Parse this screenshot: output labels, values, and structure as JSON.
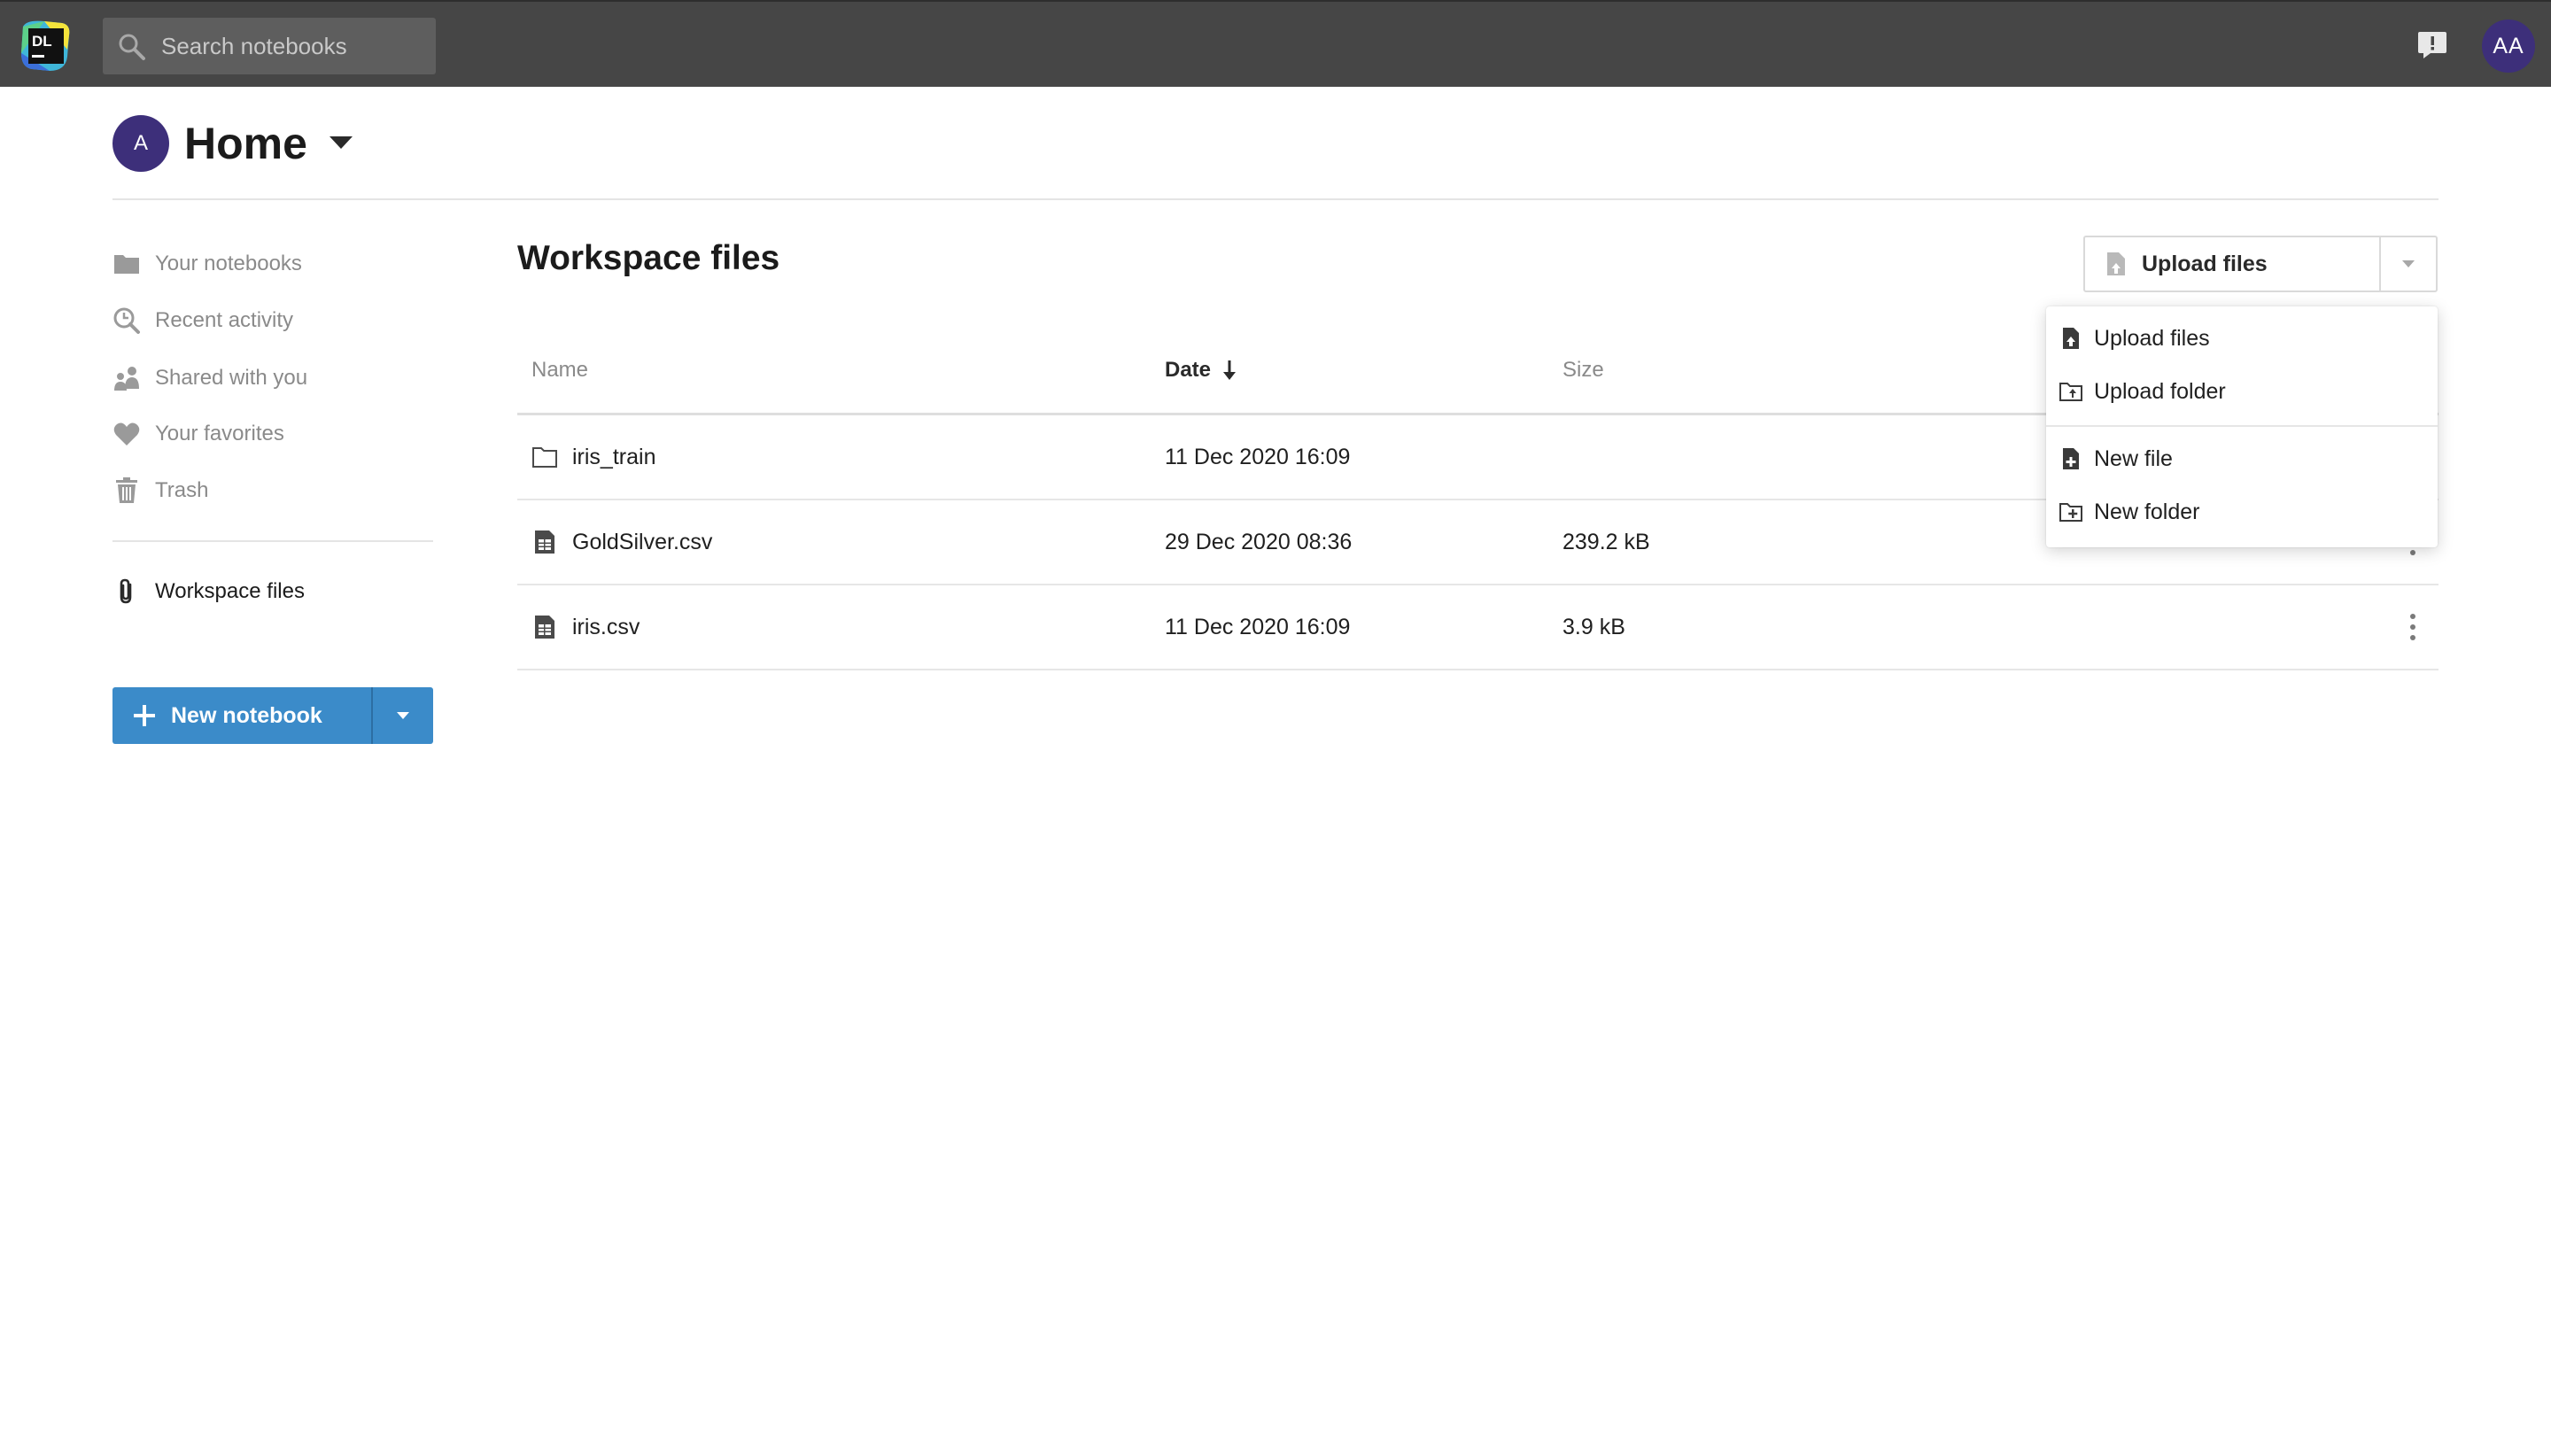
{
  "topbar": {
    "logo_text": "DL",
    "search_placeholder": "Search notebooks",
    "user_initials": "AA"
  },
  "header": {
    "avatar_initial": "A",
    "title": "Home"
  },
  "sidebar": {
    "items": [
      {
        "label": "Your notebooks",
        "icon": "folder-icon"
      },
      {
        "label": "Recent activity",
        "icon": "clock-search-icon"
      },
      {
        "label": "Shared with you",
        "icon": "people-icon"
      },
      {
        "label": "Your favorites",
        "icon": "heart-icon"
      },
      {
        "label": "Trash",
        "icon": "trash-icon"
      }
    ],
    "workspace_label": "Workspace files",
    "new_notebook_label": "New notebook"
  },
  "main": {
    "title": "Workspace files",
    "upload_label": "Upload files",
    "columns": {
      "name": "Name",
      "date": "Date",
      "size": "Size"
    },
    "rows": [
      {
        "name": "iris_train",
        "type": "folder",
        "date": "11 Dec 2020 16:09",
        "size": ""
      },
      {
        "name": "GoldSilver.csv",
        "type": "file",
        "date": "29 Dec 2020 08:36",
        "size": "239.2 kB"
      },
      {
        "name": "iris.csv",
        "type": "file",
        "date": "11 Dec 2020 16:09",
        "size": "3.9 kB"
      }
    ]
  },
  "menu": {
    "items": [
      "Upload files",
      "Upload folder",
      "New file",
      "New folder"
    ]
  },
  "colors": {
    "topbar": "#464646",
    "accent_button": "#3b8bc9",
    "avatar": "#3d2f7a"
  }
}
